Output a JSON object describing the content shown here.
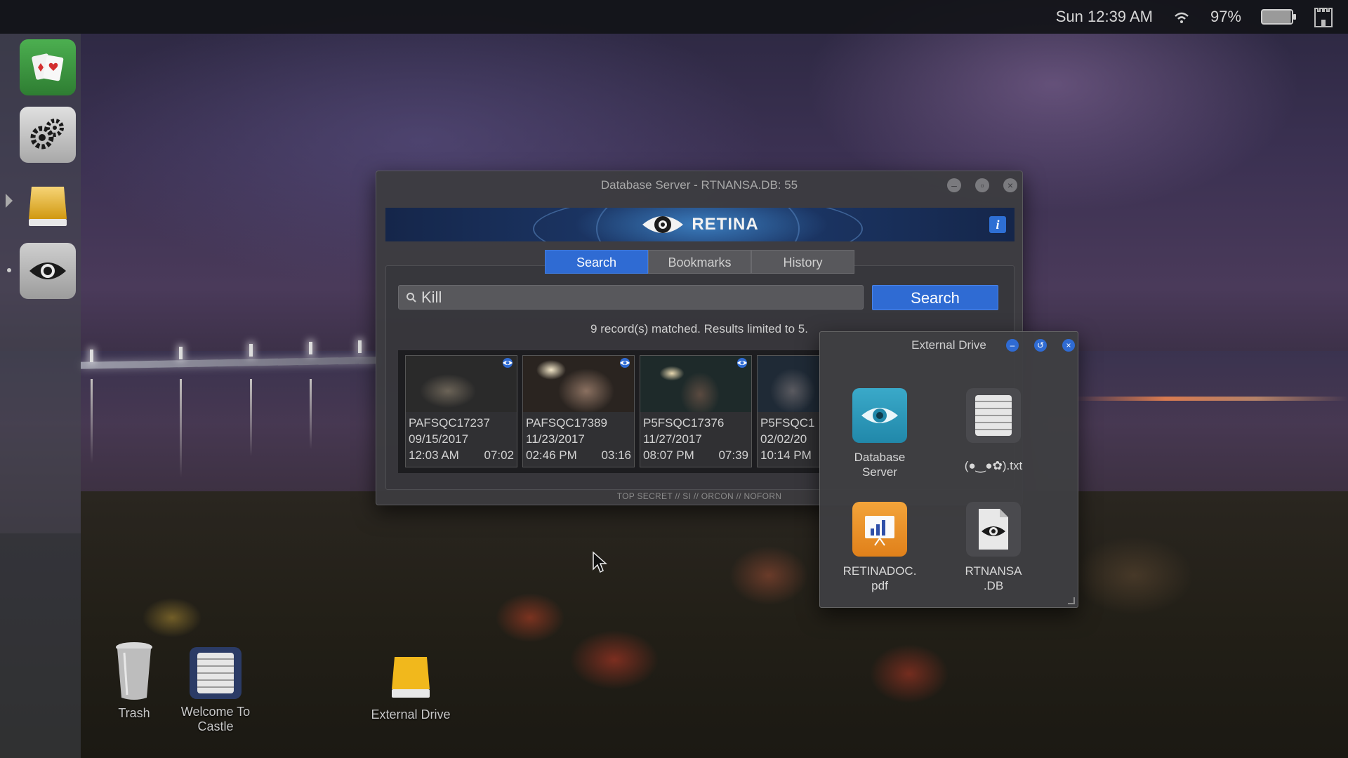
{
  "topbar": {
    "datetime": "Sun 12:39 AM",
    "battery": "97%"
  },
  "dock": {
    "items": [
      {
        "name": "solitaire-app",
        "icon": "playing-cards-icon"
      },
      {
        "name": "settings-app",
        "icon": "gears-icon"
      },
      {
        "name": "external-drive-app",
        "icon": "drive-icon"
      },
      {
        "name": "retina-app",
        "icon": "eye-icon"
      }
    ]
  },
  "desktop": {
    "icons": [
      {
        "label": "Trash",
        "icon": "trash-icon"
      },
      {
        "label": "Welcome To Castle",
        "icon": "text-file-icon"
      },
      {
        "label": "External Drive",
        "icon": "drive-icon"
      }
    ]
  },
  "db_window": {
    "title": "Database Server - RTNANSA.DB: 55",
    "brand": "RETINA",
    "tabs": [
      {
        "label": "Search",
        "active": true
      },
      {
        "label": "Bookmarks",
        "active": false
      },
      {
        "label": "History",
        "active": false
      }
    ],
    "search": {
      "value": "Kill",
      "button_label": "Search"
    },
    "result_count": "9 record(s) matched. Results limited to 5.",
    "results": [
      {
        "id": "PAFSQC17237",
        "date": "09/15/2017",
        "time": "12:03 AM",
        "duration": "07:02"
      },
      {
        "id": "PAFSQC17389",
        "date": "11/23/2017",
        "time": "02:46 PM",
        "duration": "03:16"
      },
      {
        "id": "P5FSQC17376",
        "date": "11/27/2017",
        "time": "08:07 PM",
        "duration": "07:39"
      },
      {
        "id": "P5FSQC1",
        "date": "02/02/20",
        "time": "10:14 PM",
        "duration": ""
      }
    ],
    "classification": "TOP SECRET // SI // ORCON // NOFORN"
  },
  "ext_window": {
    "title": "External Drive",
    "files": [
      {
        "label_line1": "Database",
        "label_line2": "Server",
        "icon": "eye-icon"
      },
      {
        "label_line1": "(●‿●✿).txt",
        "label_line2": "",
        "icon": "text-file-icon"
      },
      {
        "label_line1": "RETINADOC.",
        "label_line2": "pdf",
        "icon": "chart-document-icon"
      },
      {
        "label_line1": "RTNANSA",
        "label_line2": ".DB",
        "icon": "eye-document-icon"
      }
    ]
  },
  "colors": {
    "accent": "#2f6bd3",
    "window_bg": "#3c3c40",
    "topbar_bg": "#121418"
  }
}
